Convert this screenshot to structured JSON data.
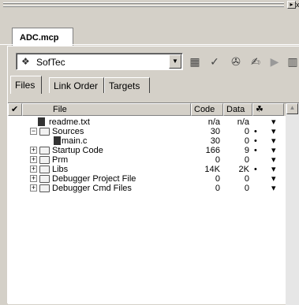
{
  "window": {
    "close_glyph": "x",
    "project_tab": "ADC.mcp"
  },
  "toolbar": {
    "target_value": "SofTec",
    "combo_arrow": "▼",
    "icons": [
      "settings-icon",
      "sync-icon",
      "check-icon",
      "debug-icon",
      "run-icon",
      "remote-icon"
    ]
  },
  "tabs": [
    "Files",
    "Link Order",
    "Targets"
  ],
  "list": {
    "columns": {
      "check": "✔",
      "file": "File",
      "code": "Code",
      "data": "Data",
      "bug": "☘"
    },
    "rows": [
      {
        "name": "readme.txt",
        "code": "n/a",
        "data": "n/a",
        "dot": "",
        "kind": "file",
        "indent": 1
      },
      {
        "name": "Sources",
        "code": "30",
        "data": "0",
        "dot": "•",
        "kind": "folder-open",
        "indent": 0
      },
      {
        "name": "main.c",
        "code": "30",
        "data": "0",
        "dot": "•",
        "kind": "file",
        "indent": 2
      },
      {
        "name": "Startup Code",
        "code": "166",
        "data": "9",
        "dot": "•",
        "kind": "folder",
        "indent": 0
      },
      {
        "name": "Prm",
        "code": "0",
        "data": "0",
        "dot": "",
        "kind": "folder",
        "indent": 0
      },
      {
        "name": "Libs",
        "code": "14K",
        "data": "2K",
        "dot": "•",
        "kind": "folder",
        "indent": 0
      },
      {
        "name": "Debugger Project File",
        "code": "0",
        "data": "0",
        "dot": "",
        "kind": "folder",
        "indent": 0
      },
      {
        "name": "Debugger Cmd Files",
        "code": "0",
        "data": "0",
        "dot": "",
        "kind": "folder",
        "indent": 0
      }
    ]
  },
  "colors": {
    "face": "#d4d0c8",
    "list_bg": "#ffffff",
    "shadow": "#808080"
  }
}
